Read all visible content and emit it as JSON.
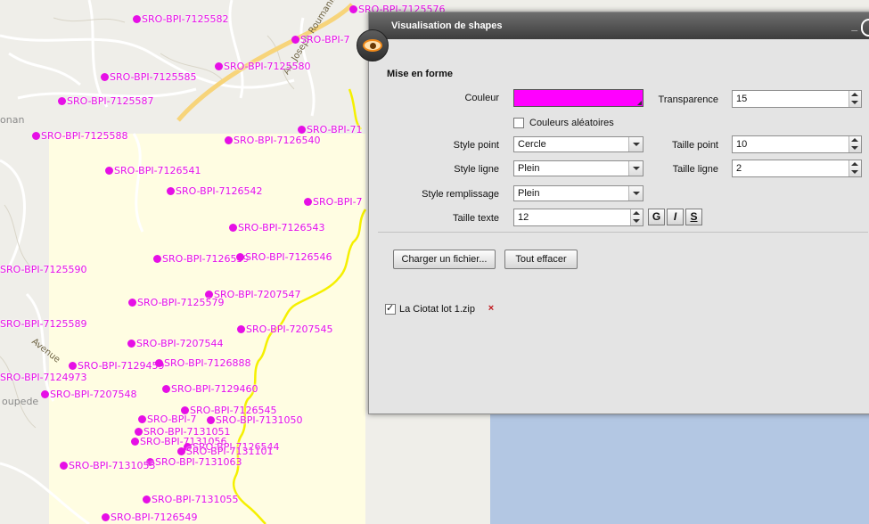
{
  "map": {
    "places": [
      "onan",
      "oupede"
    ],
    "roads": [
      "Av. Joseph Roumanille",
      "Avenue"
    ],
    "labels": [
      "SRO-BPI-7125576",
      "SRO-BPI-7125582",
      "SRO-BPI-7",
      "SRO-BPI-7125580",
      "SRO-BPI-7125585",
      "SRO-BPI-7125587",
      "SRO-BPI-7125588",
      "SRO-BPI-71",
      "SRO-BPI-7126540",
      "SRO-BPI-7126541",
      "SRO-BPI-7126542",
      "SRO-BPI-7",
      "SRO-BPI-7126543",
      "SRO-BPI-7125590",
      "SRO-BPI-7126539",
      "SRO-BPI-7126546",
      "SRO-BPI-7207547",
      "SRO-BPI-7125579",
      "SRO-BPI-7125589",
      "SRO-BPI-7207545",
      "SRO-BPI-7207544",
      "SRO-BPI-7129459",
      "SRO-BPI-7126888",
      "SRO-BPI-7124973",
      "SRO-BPI-7207548",
      "SRO-BPI-7129460",
      "SRO-BPI-7126545",
      "SRO-BPI-7",
      "SRO-BPI-7131050",
      "SRO-BPI-7131051",
      "SRO-BPI-7131056",
      "SRO-BPI-7126544",
      "SRO-BPI-7131101",
      "SRO-BPI-7131063",
      "SRO-BPI-7131053",
      "SRO-BPI-7131055",
      "SRO-BPI-7126549"
    ],
    "label_color": "#e60fe6",
    "trace_color": "#f5f000"
  },
  "dialog": {
    "title": "Visualisation de shapes",
    "minimize_symbol": "_",
    "icon": "eye-icon",
    "section_title": "Mise en forme",
    "color_label": "Couleur",
    "color_value": "#ff00ff",
    "transparency_label": "Transparence",
    "transparency_value": "15",
    "random_colors_label": "Couleurs aléatoires",
    "random_colors_checked": false,
    "point_style_label": "Style point",
    "point_style_value": "Cercle",
    "point_size_label": "Taille point",
    "point_size_value": "10",
    "line_style_label": "Style ligne",
    "line_style_value": "Plein",
    "line_size_label": "Taille ligne",
    "line_size_value": "2",
    "fill_style_label": "Style remplissage",
    "fill_style_value": "Plein",
    "text_size_label": "Taille texte",
    "text_size_value": "12",
    "bold_label": "G",
    "italic_label": "I",
    "underline_label": "S",
    "load_button": "Charger un fichier...",
    "clear_button": "Tout effacer",
    "files": [
      {
        "name": "La Ciotat lot 1.zip",
        "checked": true,
        "remove_symbol": "×"
      }
    ]
  }
}
